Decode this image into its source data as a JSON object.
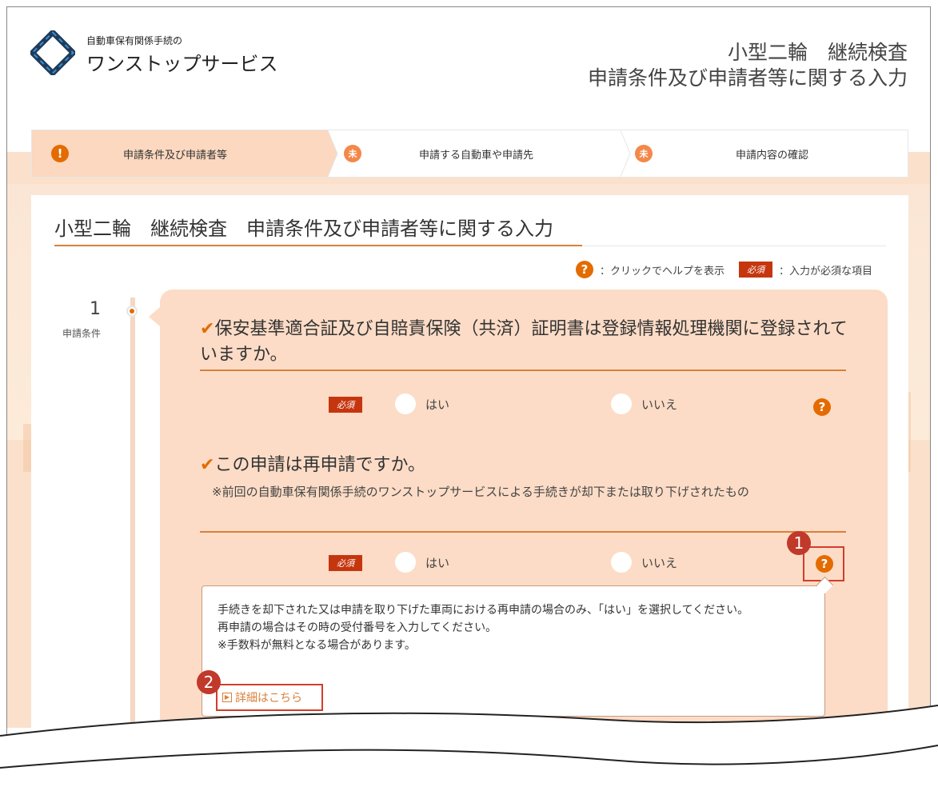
{
  "header": {
    "brand_small": "自動車保有関係手続の",
    "brand_large": "ワンストップサービス",
    "title_line1": "小型二輪　継続検査",
    "title_line2": "申請条件及び申請者等に関する入力"
  },
  "steps": [
    {
      "icon": "!",
      "label": "申請条件及び申請者等"
    },
    {
      "icon": "未",
      "label": "申請する自動車や申請先"
    },
    {
      "icon": "未",
      "label": "申請内容の確認"
    }
  ],
  "panel": {
    "title": "小型二輪　継続検査　申請条件及び申請者等に関する入力",
    "legend_help": "：クリックでヘルプを表示",
    "legend_required": "：入力が必須な項目",
    "required_badge": "必須",
    "help_glyph": "?"
  },
  "timeline": {
    "number": "1",
    "label": "申請条件"
  },
  "questions": [
    {
      "check": "✔",
      "title": "保安基準適合証及び自賠責保険（共済）証明書は登録情報処理機関に登録されていますか。",
      "required": "必須",
      "yes": "はい",
      "no": "いいえ"
    },
    {
      "check": "✔",
      "title": "この申請は再申請ですか。",
      "note": "　※前回の自動車保有関係手続のワンストップサービスによる手続きが却下または取り下げされたもの",
      "required": "必須",
      "yes": "はい",
      "no": "いいえ"
    }
  ],
  "help_popup": {
    "line1": "手続きを却下された又は申請を取り下げた車両における再申請の場合のみ、「はい」を選択してください。",
    "line2": "再申請の場合はその時の受付番号を入力してください。",
    "line3": "※手数料が無料となる場合があります。",
    "link": "詳細はこちら"
  },
  "callouts": {
    "one": "1",
    "two": "2"
  },
  "colors": {
    "accent": "#e36b00",
    "required": "#c5360f",
    "highlight": "#d23c2c",
    "card": "#fcdcc6"
  }
}
